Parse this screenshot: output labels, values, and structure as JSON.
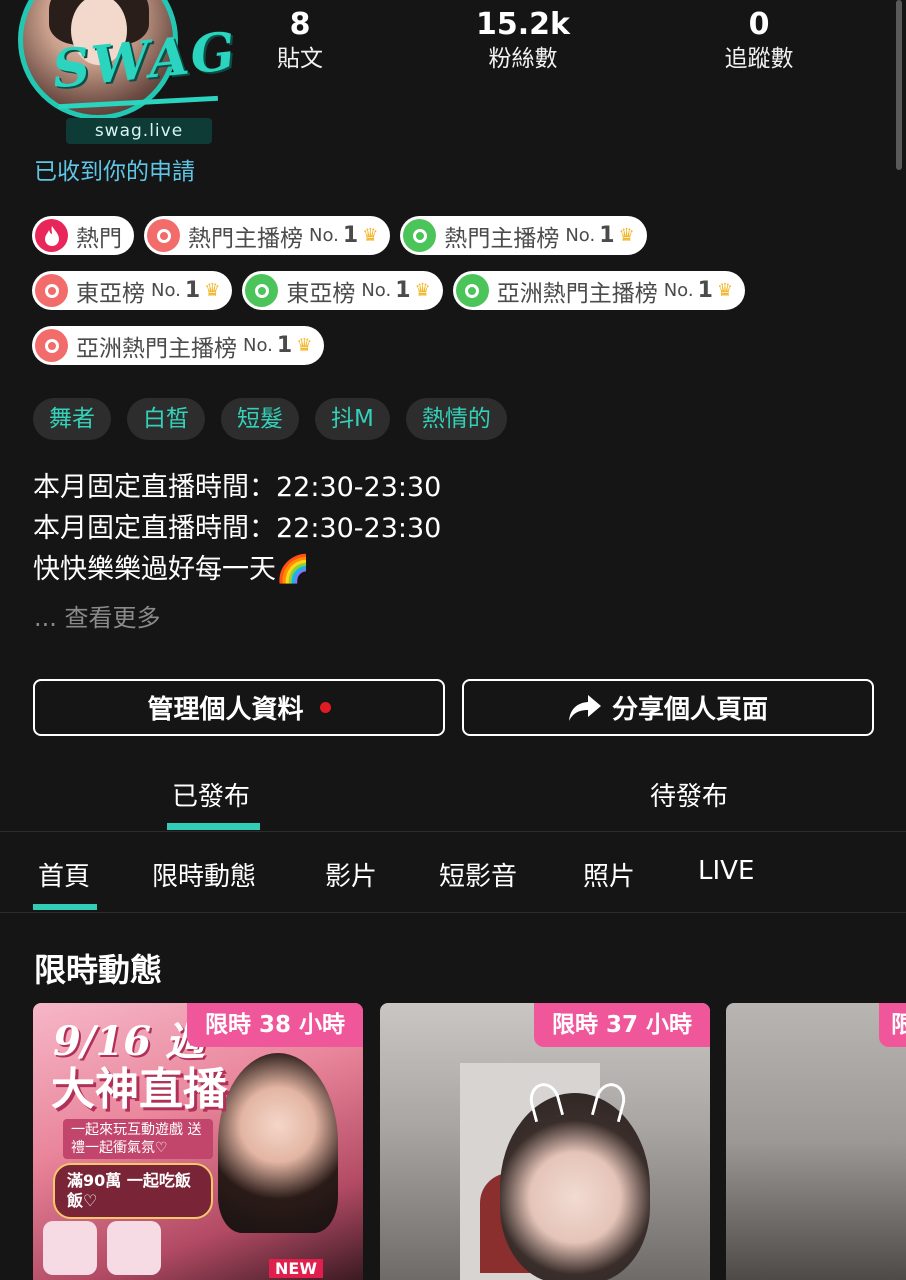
{
  "profile": {
    "site_tag": "swag.live",
    "request_status": "已收到你的申請"
  },
  "stats": [
    {
      "value": "8",
      "label": "貼文"
    },
    {
      "value": "15.2k",
      "label": "粉絲數"
    },
    {
      "value": "0",
      "label": "追蹤數"
    }
  ],
  "badges": [
    {
      "label": "熱門",
      "icon": "fire-icon",
      "color": "#e8265a"
    },
    {
      "label": "熱門主播榜",
      "rank": "No.",
      "rank_num": "1",
      "icon": "red-rank-icon",
      "color": "#f26c6c"
    },
    {
      "label": "熱門主播榜",
      "rank": "No.",
      "rank_num": "1",
      "icon": "green-rank-icon",
      "color": "#4bc45a"
    },
    {
      "label": "東亞榜",
      "rank": "No.",
      "rank_num": "1",
      "icon": "red-rank-icon",
      "color": "#f26c6c"
    },
    {
      "label": "東亞榜",
      "rank": "No.",
      "rank_num": "1",
      "icon": "green-rank-icon",
      "color": "#4bc45a"
    },
    {
      "label": "亞洲熱門主播榜",
      "rank": "No.",
      "rank_num": "1",
      "icon": "green-rank-icon",
      "color": "#4bc45a"
    },
    {
      "label": "亞洲熱門主播榜",
      "rank": "No.",
      "rank_num": "1",
      "icon": "red-rank-icon",
      "color": "#f26c6c"
    }
  ],
  "tags": [
    "舞者",
    "白皙",
    "短髮",
    "抖M",
    "熱情的"
  ],
  "bio": {
    "line1": "本月固定直播時間：22:30-23:30",
    "line2": "本月固定直播時間：22:30-23:30",
    "line3": "快快樂樂過好每一天🌈",
    "more": "... 查看更多"
  },
  "buttons": {
    "manage": "管理個人資料",
    "share": "分享個人頁面"
  },
  "post_tabs": [
    "已發布",
    "待發布"
  ],
  "section_tabs": [
    "首頁",
    "限時動態",
    "影片",
    "短影音",
    "照片",
    "LIVE"
  ],
  "stories": {
    "title": "限時動態",
    "cards": [
      {
        "timer": "限時 38 小時",
        "poster_date": "9/16 週",
        "poster_big": "大神直播",
        "poster_sub": "一起來玩互動遊戲 送禮一起衝氣氛♡",
        "poster_gift": "滿90萬 一起吃飯飯♡",
        "badge": "NEW"
      },
      {
        "timer": "限時 37 小時"
      },
      {
        "timer": "限"
      }
    ]
  },
  "colors": {
    "accent": "#31cdb6",
    "link": "#5fc6e6",
    "timer_bg": "#f0579a",
    "notify_dot": "#e01b24"
  }
}
